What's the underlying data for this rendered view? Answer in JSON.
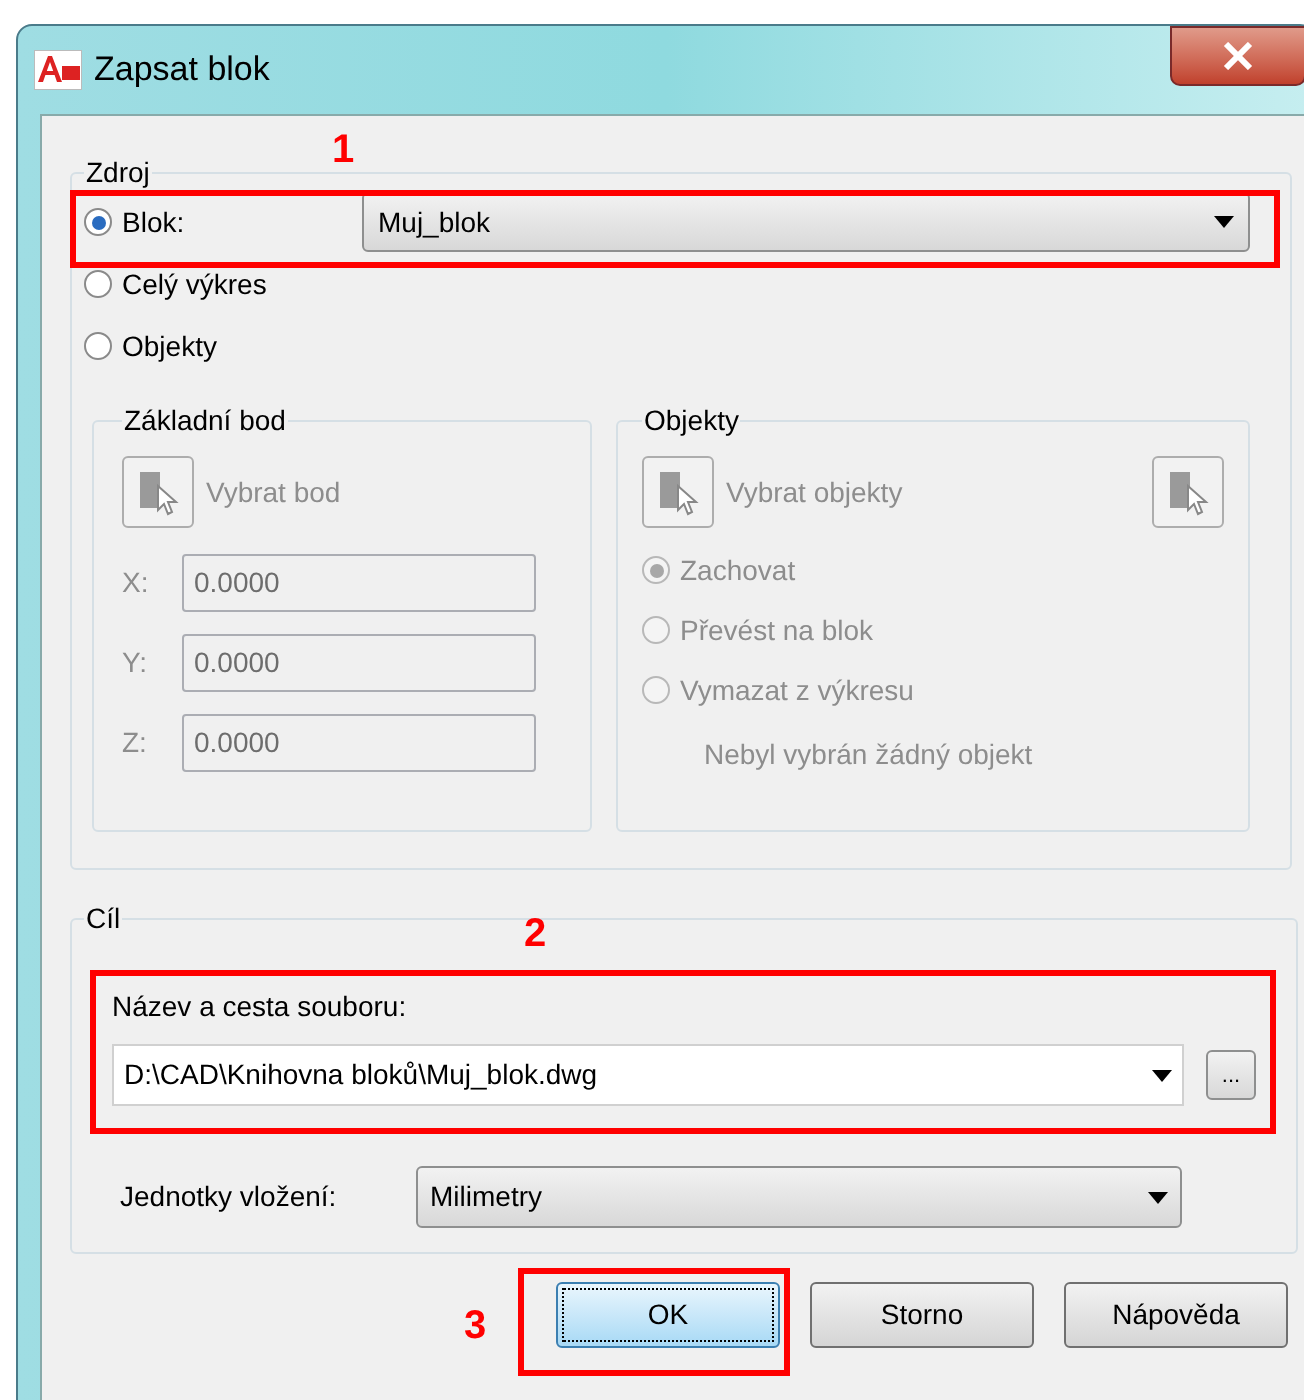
{
  "window": {
    "title": "Zapsat blok"
  },
  "source": {
    "legend": "Zdroj",
    "options": [
      {
        "label": "Blok:",
        "selected": true
      },
      {
        "label": "Celý výkres",
        "selected": false
      },
      {
        "label": "Objekty",
        "selected": false
      }
    ],
    "block_dropdown": {
      "value": "Muj_blok"
    }
  },
  "base_point": {
    "legend": "Základní bod",
    "disabled": true,
    "pick_button": "Vybrat bod",
    "coords": [
      {
        "label": "X:",
        "value": "0.0000"
      },
      {
        "label": "Y:",
        "value": "0.0000"
      },
      {
        "label": "Z:",
        "value": "0.0000"
      }
    ]
  },
  "objects": {
    "legend": "Objekty",
    "disabled": true,
    "select_button": "Vybrat objekty",
    "options": [
      {
        "label": "Zachovat",
        "selected": true
      },
      {
        "label": "Převést na blok",
        "selected": false
      },
      {
        "label": "Vymazat z výkresu",
        "selected": false
      }
    ],
    "status": "Nebyl vybrán žádný objekt"
  },
  "destination": {
    "legend": "Cíl",
    "file_label": "Název a cesta souboru:",
    "file_path": "D:\\CAD\\Knihovna bloků\\Muj_blok.dwg",
    "browse_button": "...",
    "units_label": "Jednotky vložení:",
    "units": "Milimetry"
  },
  "buttons": [
    {
      "label": "OK",
      "focused": true
    },
    {
      "label": "Storno",
      "focused": false
    },
    {
      "label": "Nápověda",
      "focused": false
    }
  ],
  "annotations": [
    {
      "label": "1"
    },
    {
      "label": "2"
    },
    {
      "label": "3"
    }
  ]
}
